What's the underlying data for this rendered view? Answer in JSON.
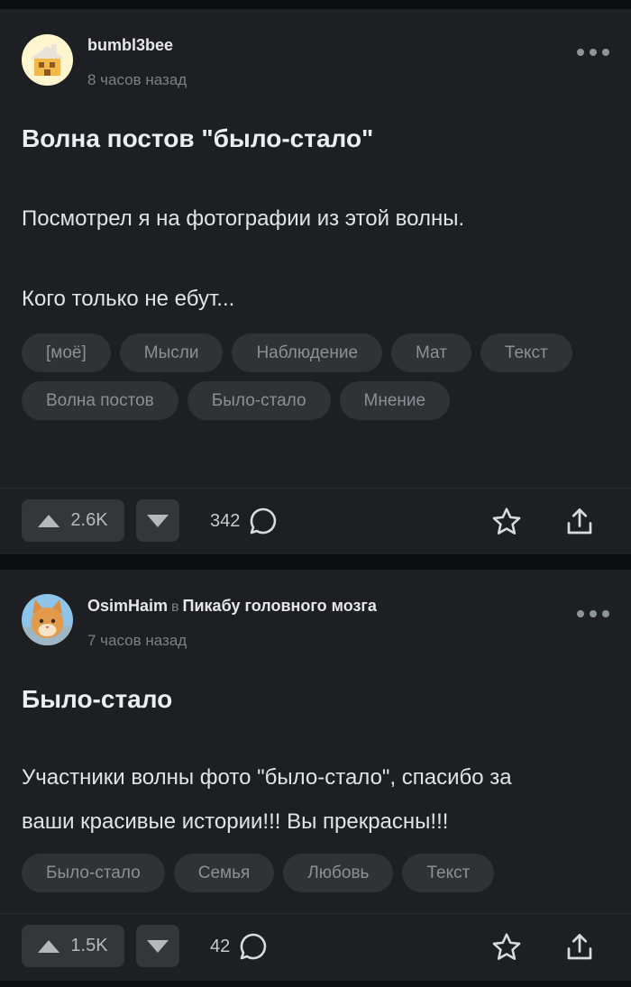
{
  "posts": [
    {
      "author": "bumbl3bee",
      "community_prefix": "",
      "community": "",
      "time": "8 часов назад",
      "title": "Волна постов \"было-стало\"",
      "paragraphs": [
        "Посмотрел я на фотографии из этой волны.",
        "Кого только не ебут..."
      ],
      "tags": [
        "[моё]",
        "Мысли",
        "Наблюдение",
        "Мат",
        "Текст",
        "Волна постов",
        "Было-стало",
        "Мнение"
      ],
      "upvotes": "2.6K",
      "comments": "342",
      "avatar_icon": "house-cartoon-avatar"
    },
    {
      "author": "OsimHaim",
      "community_prefix": "в",
      "community": "Пикабу головного мозга",
      "time": "7 часов назад",
      "title": "Было-стало",
      "paragraphs": [
        "Участники волны фото \"было-стало\", спасибо за",
        "ваши красивые истории!!! Вы прекрасны!!!"
      ],
      "tags": [
        "Было-стало",
        "Семья",
        "Любовь",
        "Текст"
      ],
      "upvotes": "1.5K",
      "comments": "42",
      "avatar_icon": "cat-photo-avatar"
    }
  ],
  "icons": {
    "more": "more-dots-icon",
    "upvote": "triangle-up-icon",
    "downvote": "triangle-down-icon",
    "comment": "speech-bubble-icon",
    "save": "star-icon",
    "share": "share-upload-icon"
  },
  "colors": {
    "background": "#0c0d0f",
    "card": "#1d1f22",
    "chip": "#303236",
    "vote_button": "#34363a"
  }
}
